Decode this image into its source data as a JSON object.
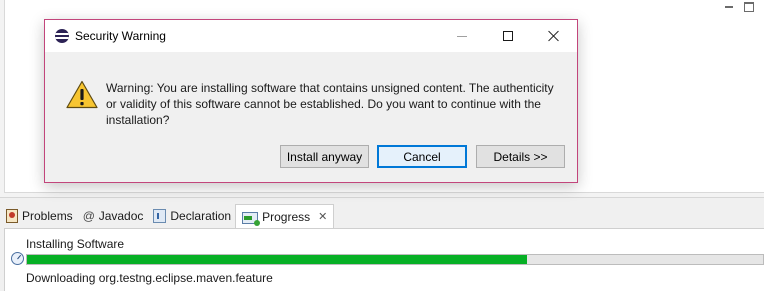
{
  "dialog": {
    "title": "Security Warning",
    "message": "Warning: You are installing software that contains unsigned content. The authenticity or validity of this software cannot be established. Do you want to continue with the installation?",
    "buttons": {
      "install": "Install anyway",
      "cancel": "Cancel",
      "details": "Details >>"
    },
    "default_button": "cancel",
    "border_color": "#c2457b"
  },
  "views": {
    "tabs": [
      {
        "label": "Problems",
        "icon": "problems-icon"
      },
      {
        "label": "Javadoc",
        "icon": "javadoc-icon",
        "glyph": "@"
      },
      {
        "label": "Declaration",
        "icon": "declaration-icon"
      },
      {
        "label": "Progress",
        "icon": "progress-icon",
        "active": true,
        "close": "✕"
      }
    ]
  },
  "progress": {
    "job_title": "Installing Software",
    "status": "Downloading org.testng.eclipse.maven.feature",
    "fraction": 0.68,
    "fill_color": "#06b025"
  }
}
